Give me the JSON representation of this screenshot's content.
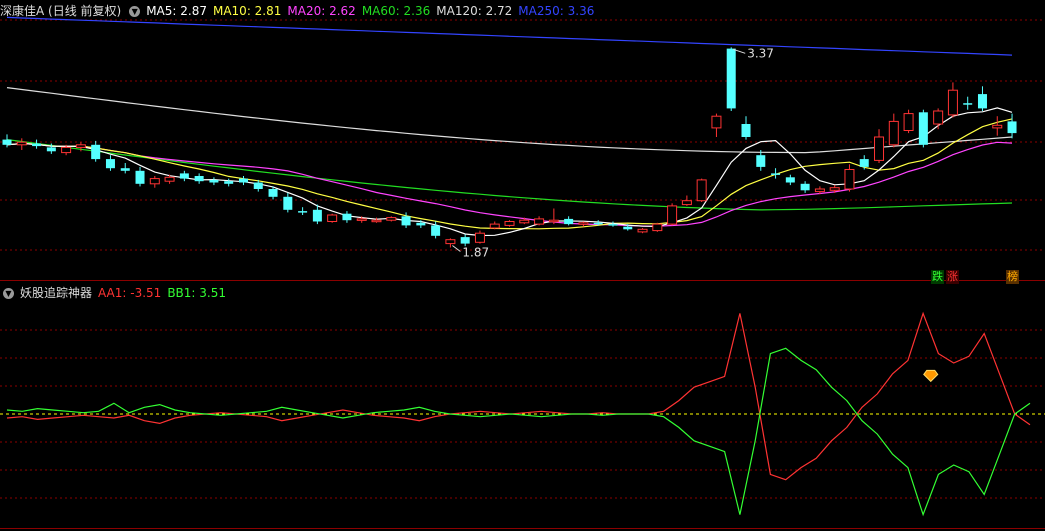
{
  "main_header": {
    "title": "深康佳A (日线 前复权)",
    "ma": [
      {
        "label": "MA5: 2.87",
        "color": "#ffffff"
      },
      {
        "label": "MA10: 2.81",
        "color": "#ffff44"
      },
      {
        "label": "MA20: 2.62",
        "color": "#ff44ff"
      },
      {
        "label": "MA60: 2.36",
        "color": "#22dd22"
      },
      {
        "label": "MA120: 2.72",
        "color": "#dddddd"
      },
      {
        "label": "MA250: 3.36",
        "color": "#3344ff"
      }
    ]
  },
  "sub_header": {
    "title": "妖股追踪神器",
    "aa1": "AA1: -3.51",
    "bb1": "BB1: 3.51",
    "aa1_color": "#ff3333",
    "bb1_color": "#33ff33"
  },
  "annotations": {
    "high": "3.37",
    "low": "1.87"
  },
  "tags": {
    "t1": "跌",
    "t2": "涨",
    "t3": "榜"
  },
  "colors": {
    "up": "#ff3333",
    "down": "#55ffff",
    "grid": "#8b0000"
  },
  "chart_data": [
    {
      "type": "candlestick",
      "name": "深康佳A",
      "ylim": [
        1.6,
        3.6
      ],
      "candles": [
        {
          "o": 2.68,
          "h": 2.72,
          "l": 2.62,
          "c": 2.64
        },
        {
          "o": 2.64,
          "h": 2.69,
          "l": 2.6,
          "c": 2.66
        },
        {
          "o": 2.65,
          "h": 2.68,
          "l": 2.61,
          "c": 2.63
        },
        {
          "o": 2.62,
          "h": 2.65,
          "l": 2.57,
          "c": 2.59
        },
        {
          "o": 2.58,
          "h": 2.64,
          "l": 2.56,
          "c": 2.62
        },
        {
          "o": 2.62,
          "h": 2.66,
          "l": 2.59,
          "c": 2.64
        },
        {
          "o": 2.64,
          "h": 2.67,
          "l": 2.51,
          "c": 2.53
        },
        {
          "o": 2.53,
          "h": 2.56,
          "l": 2.44,
          "c": 2.46
        },
        {
          "o": 2.46,
          "h": 2.5,
          "l": 2.42,
          "c": 2.44
        },
        {
          "o": 2.44,
          "h": 2.47,
          "l": 2.32,
          "c": 2.34
        },
        {
          "o": 2.34,
          "h": 2.4,
          "l": 2.31,
          "c": 2.38
        },
        {
          "o": 2.36,
          "h": 2.41,
          "l": 2.34,
          "c": 2.39
        },
        {
          "o": 2.42,
          "h": 2.44,
          "l": 2.36,
          "c": 2.38
        },
        {
          "o": 2.4,
          "h": 2.42,
          "l": 2.34,
          "c": 2.36
        },
        {
          "o": 2.37,
          "h": 2.39,
          "l": 2.33,
          "c": 2.35
        },
        {
          "o": 2.36,
          "h": 2.38,
          "l": 2.32,
          "c": 2.34
        },
        {
          "o": 2.38,
          "h": 2.4,
          "l": 2.33,
          "c": 2.35
        },
        {
          "o": 2.35,
          "h": 2.37,
          "l": 2.28,
          "c": 2.3
        },
        {
          "o": 2.3,
          "h": 2.32,
          "l": 2.22,
          "c": 2.24
        },
        {
          "o": 2.24,
          "h": 2.27,
          "l": 2.12,
          "c": 2.14
        },
        {
          "o": 2.13,
          "h": 2.16,
          "l": 2.1,
          "c": 2.12
        },
        {
          "o": 2.14,
          "h": 2.18,
          "l": 2.03,
          "c": 2.05
        },
        {
          "o": 2.05,
          "h": 2.11,
          "l": 2.04,
          "c": 2.1
        },
        {
          "o": 2.11,
          "h": 2.13,
          "l": 2.04,
          "c": 2.06
        },
        {
          "o": 2.06,
          "h": 2.09,
          "l": 2.04,
          "c": 2.07
        },
        {
          "o": 2.05,
          "h": 2.08,
          "l": 2.04,
          "c": 2.06
        },
        {
          "o": 2.06,
          "h": 2.09,
          "l": 2.05,
          "c": 2.08
        },
        {
          "o": 2.09,
          "h": 2.12,
          "l": 2.0,
          "c": 2.02
        },
        {
          "o": 2.04,
          "h": 2.06,
          "l": 2.0,
          "c": 2.02
        },
        {
          "o": 2.02,
          "h": 2.05,
          "l": 1.92,
          "c": 1.94
        },
        {
          "o": 1.88,
          "h": 1.92,
          "l": 1.85,
          "c": 1.91
        },
        {
          "o": 1.93,
          "h": 1.95,
          "l": 1.86,
          "c": 1.88
        },
        {
          "o": 1.89,
          "h": 1.98,
          "l": 1.88,
          "c": 1.96
        },
        {
          "o": 2.0,
          "h": 2.05,
          "l": 1.99,
          "c": 2.03
        },
        {
          "o": 2.02,
          "h": 2.06,
          "l": 2.01,
          "c": 2.05
        },
        {
          "o": 2.04,
          "h": 2.08,
          "l": 2.03,
          "c": 2.06
        },
        {
          "o": 2.03,
          "h": 2.09,
          "l": 2.02,
          "c": 2.07
        },
        {
          "o": 2.05,
          "h": 2.15,
          "l": 2.03,
          "c": 2.06
        },
        {
          "o": 2.07,
          "h": 2.09,
          "l": 2.02,
          "c": 2.03
        },
        {
          "o": 2.03,
          "h": 2.05,
          "l": 2.01,
          "c": 2.04
        },
        {
          "o": 2.04,
          "h": 2.06,
          "l": 2.02,
          "c": 2.03
        },
        {
          "o": 2.03,
          "h": 2.05,
          "l": 2.01,
          "c": 2.02
        },
        {
          "o": 2.01,
          "h": 2.03,
          "l": 1.98,
          "c": 1.99
        },
        {
          "o": 1.97,
          "h": 2.0,
          "l": 1.96,
          "c": 1.99
        },
        {
          "o": 1.98,
          "h": 2.04,
          "l": 1.97,
          "c": 2.03
        },
        {
          "o": 2.03,
          "h": 2.19,
          "l": 2.02,
          "c": 2.17
        },
        {
          "o": 2.18,
          "h": 2.25,
          "l": 2.17,
          "c": 2.21
        },
        {
          "o": 2.21,
          "h": 2.38,
          "l": 2.2,
          "c": 2.37
        },
        {
          "o": 2.77,
          "h": 2.88,
          "l": 2.7,
          "c": 2.86
        },
        {
          "o": 3.38,
          "h": 3.39,
          "l": 2.9,
          "c": 2.92
        },
        {
          "o": 2.8,
          "h": 2.86,
          "l": 2.68,
          "c": 2.7
        },
        {
          "o": 2.56,
          "h": 2.6,
          "l": 2.44,
          "c": 2.47
        },
        {
          "o": 2.42,
          "h": 2.46,
          "l": 2.38,
          "c": 2.41
        },
        {
          "o": 2.39,
          "h": 2.41,
          "l": 2.33,
          "c": 2.35
        },
        {
          "o": 2.34,
          "h": 2.36,
          "l": 2.27,
          "c": 2.29
        },
        {
          "o": 2.28,
          "h": 2.32,
          "l": 2.26,
          "c": 2.3
        },
        {
          "o": 2.29,
          "h": 2.33,
          "l": 2.27,
          "c": 2.31
        },
        {
          "o": 2.3,
          "h": 2.49,
          "l": 2.28,
          "c": 2.45
        },
        {
          "o": 2.53,
          "h": 2.56,
          "l": 2.45,
          "c": 2.47
        },
        {
          "o": 2.52,
          "h": 2.76,
          "l": 2.5,
          "c": 2.7
        },
        {
          "o": 2.64,
          "h": 2.88,
          "l": 2.62,
          "c": 2.82
        },
        {
          "o": 2.75,
          "h": 2.91,
          "l": 2.73,
          "c": 2.88
        },
        {
          "o": 2.89,
          "h": 2.91,
          "l": 2.62,
          "c": 2.64
        },
        {
          "o": 2.8,
          "h": 2.92,
          "l": 2.76,
          "c": 2.9
        },
        {
          "o": 2.87,
          "h": 3.12,
          "l": 2.85,
          "c": 3.06
        },
        {
          "o": 2.96,
          "h": 3.01,
          "l": 2.91,
          "c": 2.95
        },
        {
          "o": 3.03,
          "h": 3.09,
          "l": 2.9,
          "c": 2.92
        },
        {
          "o": 2.77,
          "h": 2.86,
          "l": 2.71,
          "c": 2.79
        },
        {
          "o": 2.82,
          "h": 2.88,
          "l": 2.69,
          "c": 2.73
        }
      ]
    },
    {
      "type": "line",
      "name": "妖股追踪神器",
      "ylim": [
        -8.5,
        8.5
      ],
      "series": [
        {
          "name": "AA1",
          "color": "#ff3333",
          "values": [
            -0.3,
            -0.2,
            -0.4,
            -0.3,
            -0.2,
            -0.1,
            -0.2,
            -0.3,
            -0.1,
            -0.5,
            -0.7,
            -0.3,
            -0.1,
            0.0,
            0.1,
            0.0,
            -0.1,
            -0.2,
            -0.5,
            -0.3,
            -0.1,
            0.1,
            0.3,
            0.1,
            -0.1,
            -0.2,
            -0.3,
            -0.5,
            -0.2,
            0.0,
            0.1,
            0.2,
            0.1,
            0.0,
            0.1,
            0.2,
            0.1,
            0.0,
            0.0,
            0.1,
            0.0,
            0.0,
            0.0,
            0.2,
            1.0,
            2.0,
            2.4,
            2.8,
            7.5,
            2.0,
            -4.5,
            -4.9,
            -4.0,
            -3.3,
            -2.0,
            -1.0,
            0.5,
            1.5,
            3.0,
            4.0,
            7.5,
            4.5,
            3.8,
            4.3,
            6.0,
            3.0,
            0.0,
            -0.8
          ]
        },
        {
          "name": "BB1",
          "color": "#33ff33",
          "values": [
            0.3,
            0.2,
            0.4,
            0.3,
            0.2,
            0.1,
            0.2,
            0.8,
            0.1,
            0.5,
            0.7,
            0.3,
            0.1,
            0.0,
            -0.1,
            0.0,
            0.1,
            0.2,
            0.5,
            0.3,
            0.1,
            -0.1,
            -0.3,
            -0.1,
            0.1,
            0.2,
            0.3,
            0.5,
            0.2,
            0.0,
            -0.1,
            -0.2,
            -0.1,
            0.0,
            -0.1,
            -0.2,
            -0.1,
            0.0,
            0.0,
            -0.1,
            0.0,
            0.0,
            0.0,
            -0.2,
            -1.0,
            -2.0,
            -2.4,
            -2.8,
            -7.5,
            -2.0,
            4.5,
            4.9,
            4.0,
            3.3,
            2.0,
            1.0,
            -0.5,
            -1.5,
            -3.0,
            -4.0,
            -7.5,
            -4.5,
            -3.8,
            -4.3,
            -6.0,
            -3.0,
            0.0,
            0.8
          ]
        }
      ]
    }
  ]
}
